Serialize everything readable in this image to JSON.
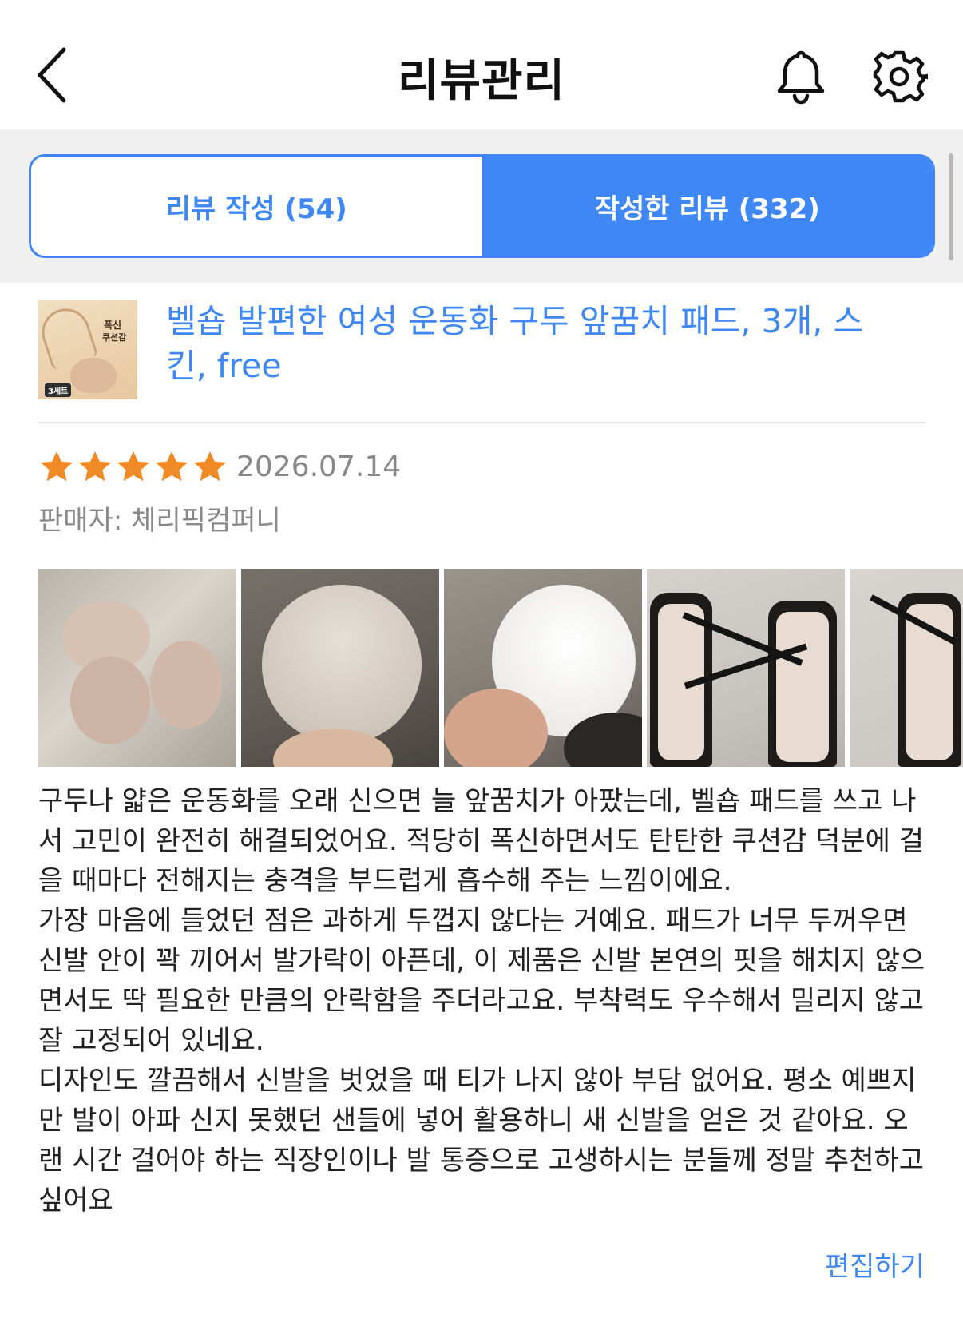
{
  "header": {
    "title": "리뷰관리",
    "back_icon": "chevron-left-icon",
    "bell_icon": "bell-icon",
    "settings_icon": "gear-icon"
  },
  "tabs": {
    "write": "리뷰 작성 (54)",
    "written": "작성한 리뷰 (332)",
    "active": "written"
  },
  "colors": {
    "accent": "#3f87f5",
    "star": "#f08a24",
    "muted_text": "#888888"
  },
  "product": {
    "name": "벨숍 발편한 여성 운동화 구두 앞꿈치 패드, 3개, 스킨, free",
    "thumbnail_badge_line1": "폭신",
    "thumbnail_badge_line2": "쿠션감",
    "thumbnail_set": "3세트"
  },
  "review": {
    "rating": 5,
    "rating_max": 5,
    "date": "2026.07.14",
    "seller": "판매자: 체리픽컴퍼니",
    "photo_count_visible": 5,
    "paragraphs": [
      "구두나 얇은 운동화를 오래 신으면 늘 앞꿈치가 아팠는데, 벨숍 패드를 쓰고 나서 고민이 완전히 해결되었어요. 적당히 폭신하면서도 탄탄한 쿠션감 덕분에 걸을 때마다 전해지는 충격을 부드럽게 흡수해 주는 느낌이에요.",
      "가장 마음에 들었던 점은 과하게 두껍지 않다는 거예요. 패드가 너무 두꺼우면 신발 안이 꽉 끼어서 발가락이 아픈데, 이 제품은 신발 본연의 핏을 해치지 않으면서도 딱 필요한 만큼의 안락함을 주더라고요. 부착력도 우수해서 밀리지 않고 잘 고정되어 있네요.",
      "디자인도 깔끔해서 신발을 벗었을 때 티가 나지 않아 부담 없어요. 평소 예쁘지만 발이 아파 신지 못했던 샌들에 넣어 활용하니 새 신발을 얻은 것 같아요. 오랜 시간 걸어야 하는 직장인이나 발 통증으로 고생하시는 분들께 정말 추천하고 싶어요"
    ],
    "edit_label": "편집하기"
  }
}
